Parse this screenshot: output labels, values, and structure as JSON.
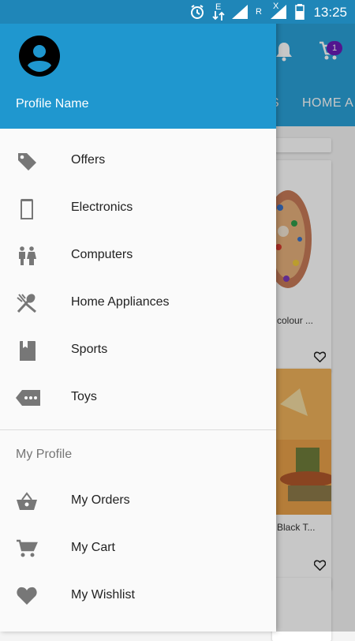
{
  "status": {
    "time": "13:25",
    "network_e": "E",
    "network_r": "R",
    "network_x": "X"
  },
  "app": {
    "tab_left_fragment": "S",
    "tab_home": "HOME A",
    "cart_badge": "1",
    "cards": [
      {
        "title": "colour ..."
      },
      {
        "title": "Black T..."
      }
    ]
  },
  "drawer": {
    "profile_name": "Profile Name",
    "menu": [
      {
        "label": "Offers",
        "icon": "tag-icon"
      },
      {
        "label": "Electronics",
        "icon": "smartphone-icon"
      },
      {
        "label": "Computers",
        "icon": "people-icon"
      },
      {
        "label": "Home Appliances",
        "icon": "utensils-icon"
      },
      {
        "label": "Sports",
        "icon": "book-icon"
      },
      {
        "label": "Toys",
        "icon": "label-more-icon"
      }
    ],
    "section_title": "My Profile",
    "profile_menu": [
      {
        "label": "My Orders",
        "icon": "basket-icon"
      },
      {
        "label": "My Cart",
        "icon": "cart-icon"
      },
      {
        "label": "My Wishlist",
        "icon": "heart-icon"
      }
    ]
  },
  "colors": {
    "header": "#1f97cf",
    "appbar": "#2aa1d8",
    "statusbar": "#1f86b8",
    "badge": "#6a1bb8"
  }
}
